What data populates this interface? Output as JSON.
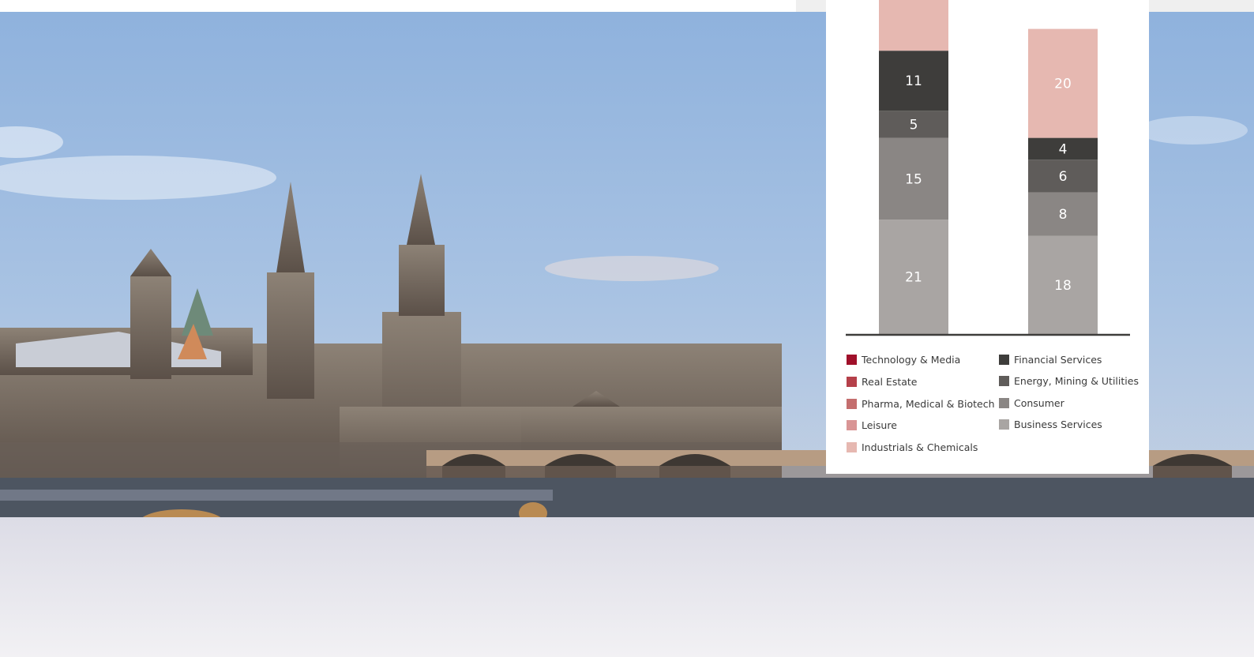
{
  "legend": {
    "items": [
      {
        "label": "Technology & Media",
        "color": "#a0102a"
      },
      {
        "label": "Real Estate",
        "color": "#b5404a"
      },
      {
        "label": "Pharma, Medical & Biotech",
        "color": "#c46e6e"
      },
      {
        "label": "Leisure",
        "color": "#d99595"
      },
      {
        "label": "Industrials & Chemicals",
        "color": "#e6b8b1"
      },
      {
        "label": "Financial Services",
        "color": "#3e3d3b"
      },
      {
        "label": "Energy, Mining & Utilities",
        "color": "#5f5c5a"
      },
      {
        "label": "Consumer",
        "color": "#8a8684"
      },
      {
        "label": "Business Services",
        "color": "#a9a5a3"
      }
    ]
  },
  "chart_data": {
    "type": "bar",
    "stacked": true,
    "categories": [
      "",
      ""
    ],
    "series": [
      {
        "name": "Business Services",
        "color": "#a9a5a3",
        "values": [
          21,
          18
        ]
      },
      {
        "name": "Consumer",
        "color": "#8a8684",
        "values": [
          15,
          8
        ]
      },
      {
        "name": "Energy, Mining & Utilities",
        "color": "#5f5c5a",
        "values": [
          5,
          6
        ]
      },
      {
        "name": "Financial Services",
        "color": "#3e3d3b",
        "values": [
          11,
          4
        ]
      },
      {
        "name": "Industrials & Chemicals",
        "color": "#e6b8b1",
        "values": [
          null,
          20
        ]
      }
    ],
    "legend_position": "bottom"
  }
}
